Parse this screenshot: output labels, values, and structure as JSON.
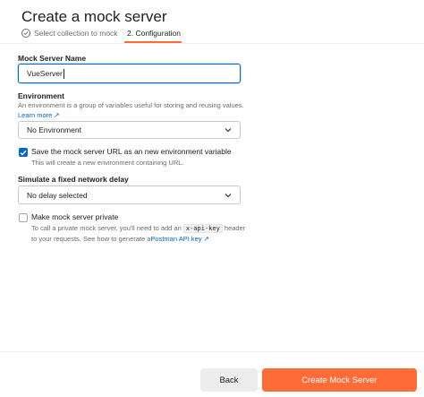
{
  "header": {
    "title": "Create a mock server",
    "step1_label": "Select collection to mock",
    "step2_label": "2. Configuration"
  },
  "name_field": {
    "label": "Mock Server Name",
    "value": "VueServer"
  },
  "environment": {
    "label": "Environment",
    "description": "An environment is a group of variables useful for storing and reusing values.",
    "learn_more": "Learn more ↗",
    "selected": "No Environment"
  },
  "save_url": {
    "checked": true,
    "label": "Save the mock server URL as an new environment variable",
    "help": "This will create a new environment containing URL."
  },
  "delay": {
    "label": "Simulate a fixed network delay",
    "selected": "No delay selected"
  },
  "private": {
    "checked": false,
    "label": "Make mock server private",
    "help_line1_pre": "To call a private mock server, you'll need to add an",
    "help_code": "x-api-key",
    "help_line1_post": "header",
    "help_line2_pre": "to your requests. See how to generate a",
    "help_link": "Postman API key ↗"
  },
  "footer": {
    "back_label": "Back",
    "create_label": "Create Mock Server"
  },
  "colors": {
    "accent": "#FF6C37",
    "link": "#0265D2",
    "checkbox_checked": "#0265D2"
  },
  "icons": [
    "check-circle-icon",
    "chevron-down-icon",
    "checkmark-icon"
  ]
}
